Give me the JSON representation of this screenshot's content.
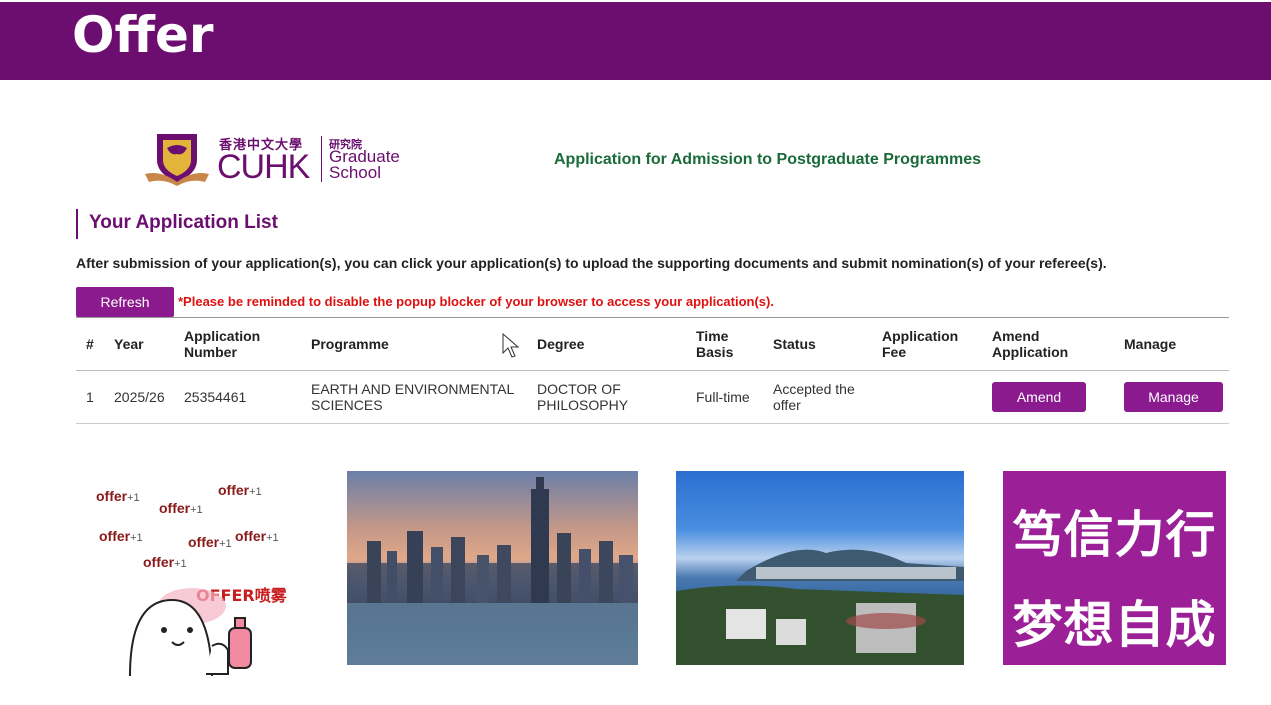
{
  "banner": {
    "title": "Offer"
  },
  "logo": {
    "chinese_name": "香港中文大學",
    "short_name": "CUHK",
    "school_chinese": "研究院",
    "school_line1": "Graduate",
    "school_line2": "School"
  },
  "header": {
    "admission_title": "Application for Admission to Postgraduate Programmes"
  },
  "section": {
    "heading": "Your Application List",
    "instruction": "After submission of your application(s), you can click your application(s) to upload the supporting documents and submit nomination(s) of your referee(s).",
    "refresh_label": "Refresh",
    "popup_warning": "*Please be reminded to disable the popup blocker of your browser to access your application(s)."
  },
  "table": {
    "headers": {
      "num": "#",
      "year": "Year",
      "app_no_1": "Application",
      "app_no_2": "Number",
      "programme": "Programme",
      "degree": "Degree",
      "basis_1": "Time",
      "basis_2": "Basis",
      "status": "Status",
      "fee_1": "Application",
      "fee_2": "Fee",
      "amend_1": "Amend",
      "amend_2": "Application",
      "manage": "Manage"
    },
    "rows": [
      {
        "num": "1",
        "year": "2025/26",
        "app_no": "25354461",
        "programme_1": "EARTH AND ENVIRONMENTAL",
        "programme_2": "SCIENCES",
        "degree_1": "DOCTOR OF",
        "degree_2": "PHILOSOPHY",
        "basis": "Full-time",
        "status_1": "Accepted the",
        "status_2": "offer",
        "fee": "",
        "amend_label": "Amend",
        "manage_label": "Manage"
      }
    ]
  },
  "gallery": {
    "sticker": {
      "items": [
        "offer",
        "offer",
        "offer",
        "offer",
        "offer",
        "offer",
        "offer"
      ],
      "plus": "+1",
      "spray": "OFFER喷雾"
    },
    "motto_line1": "笃信力行",
    "motto_line2": "梦想自成"
  },
  "colors": {
    "brand_purple": "#6b0e6f",
    "button_purple": "#8b1a8f",
    "title_green": "#1a6b3a",
    "warning_red": "#e01010"
  }
}
